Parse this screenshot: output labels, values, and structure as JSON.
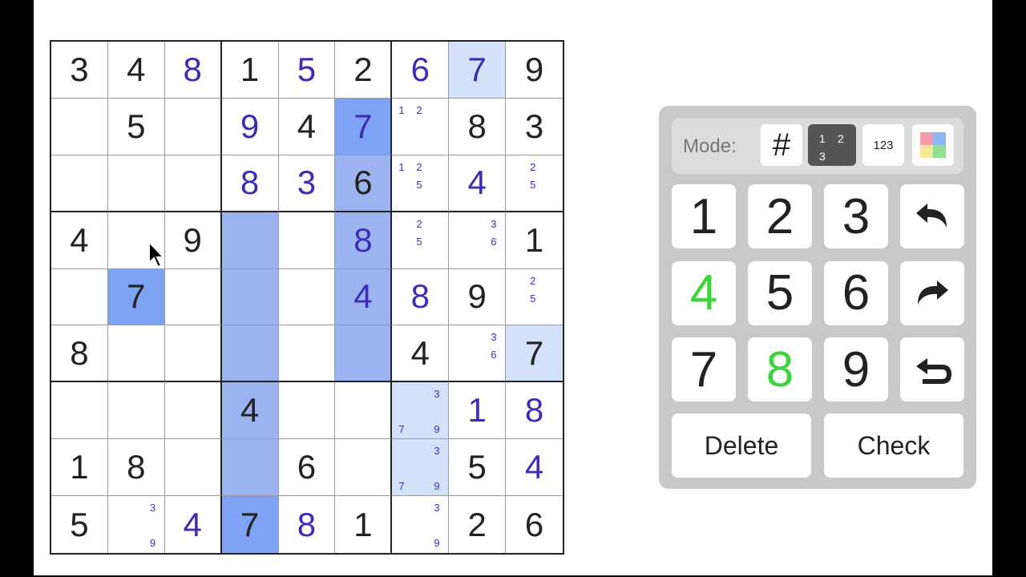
{
  "board": {
    "rows": [
      [
        {
          "v": "3",
          "t": "given"
        },
        {
          "v": "4",
          "t": "given"
        },
        {
          "v": "8",
          "t": "user"
        },
        {
          "v": "1",
          "t": "given"
        },
        {
          "v": "5",
          "t": "user"
        },
        {
          "v": "2",
          "t": "given"
        },
        {
          "v": "6",
          "t": "user"
        },
        {
          "v": "7",
          "t": "user",
          "hl": "light"
        },
        {
          "v": "9",
          "t": "given"
        }
      ],
      [
        {},
        {
          "v": "5",
          "t": "given"
        },
        {},
        {
          "v": "9",
          "t": "user"
        },
        {
          "v": "4",
          "t": "given"
        },
        {
          "v": "7",
          "t": "user",
          "hl": "strong"
        },
        {
          "notes": [
            "1",
            "2"
          ]
        },
        {
          "v": "8",
          "t": "given"
        },
        {
          "v": "3",
          "t": "given"
        }
      ],
      [
        {},
        {},
        {},
        {
          "v": "8",
          "t": "user"
        },
        {
          "v": "3",
          "t": "user"
        },
        {
          "v": "6",
          "t": "given",
          "hl": "mid"
        },
        {
          "notes": [
            "1",
            "2",
            "5"
          ]
        },
        {
          "v": "4",
          "t": "user"
        },
        {
          "notes": [
            "2",
            "5"
          ]
        }
      ],
      [
        {
          "v": "4",
          "t": "given"
        },
        {},
        {
          "v": "9",
          "t": "given"
        },
        {
          "hl": "mid"
        },
        {},
        {
          "v": "8",
          "t": "user",
          "hl": "mid"
        },
        {
          "notes": [
            "2",
            "5"
          ]
        },
        {
          "notes": [
            "3",
            "6"
          ]
        },
        {
          "v": "1",
          "t": "given"
        }
      ],
      [
        {},
        {
          "v": "7",
          "t": "given",
          "hl": "strong"
        },
        {},
        {
          "hl": "mid"
        },
        {},
        {
          "v": "4",
          "t": "user",
          "hl": "mid"
        },
        {
          "v": "8",
          "t": "user"
        },
        {
          "v": "9",
          "t": "given"
        },
        {
          "notes": [
            "2",
            "5"
          ]
        }
      ],
      [
        {
          "v": "8",
          "t": "given"
        },
        {},
        {},
        {
          "hl": "mid"
        },
        {},
        {
          "hl": "mid"
        },
        {
          "v": "4",
          "t": "given"
        },
        {
          "notes": [
            "3",
            "6"
          ]
        },
        {
          "v": "7",
          "t": "given",
          "hl": "light"
        }
      ],
      [
        {},
        {},
        {},
        {
          "v": "4",
          "t": "given",
          "hl": "mid"
        },
        {},
        {},
        {
          "notes": [
            "3",
            "7",
            "9"
          ],
          "hl": "light"
        },
        {
          "v": "1",
          "t": "user"
        },
        {
          "v": "8",
          "t": "user"
        }
      ],
      [
        {
          "v": "1",
          "t": "given"
        },
        {
          "v": "8",
          "t": "given"
        },
        {},
        {
          "hl": "mid"
        },
        {
          "v": "6",
          "t": "given"
        },
        {},
        {
          "notes": [
            "3",
            "7",
            "9"
          ],
          "hl": "light"
        },
        {
          "v": "5",
          "t": "given"
        },
        {
          "v": "4",
          "t": "user"
        }
      ],
      [
        {
          "v": "5",
          "t": "given"
        },
        {
          "notes": [
            "3",
            "9"
          ]
        },
        {
          "v": "4",
          "t": "user"
        },
        {
          "v": "7",
          "t": "given",
          "hl": "strong"
        },
        {
          "v": "8",
          "t": "user"
        },
        {
          "v": "1",
          "t": "given"
        },
        {
          "notes": [
            "3",
            "9"
          ]
        },
        {
          "v": "2",
          "t": "given"
        },
        {
          "v": "6",
          "t": "given"
        }
      ]
    ]
  },
  "colors": {
    "given_digit": "#222222",
    "user_digit": "#3c2db5",
    "highlight_light": "#d3e1fb",
    "highlight_mid": "#9bb4ef",
    "highlight_strong": "#7ea3f5",
    "complete_digit": "#3ed43e"
  },
  "controls": {
    "mode_label": "Mode:",
    "mode_normal": "#",
    "mode_corner": [
      "1",
      "2",
      "3"
    ],
    "mode_center": "123",
    "mode_color_icon": "color-swatch-icon",
    "active_mode": "corner",
    "keys": [
      {
        "label": "1"
      },
      {
        "label": "2"
      },
      {
        "label": "3"
      },
      {
        "label": "4",
        "complete": true
      },
      {
        "label": "5"
      },
      {
        "label": "6"
      },
      {
        "label": "7"
      },
      {
        "label": "8",
        "complete": true
      },
      {
        "label": "9"
      }
    ],
    "undo_icon": "undo-icon",
    "redo_icon": "redo-icon",
    "restart_icon": "restart-icon",
    "delete_label": "Delete",
    "check_label": "Check"
  }
}
